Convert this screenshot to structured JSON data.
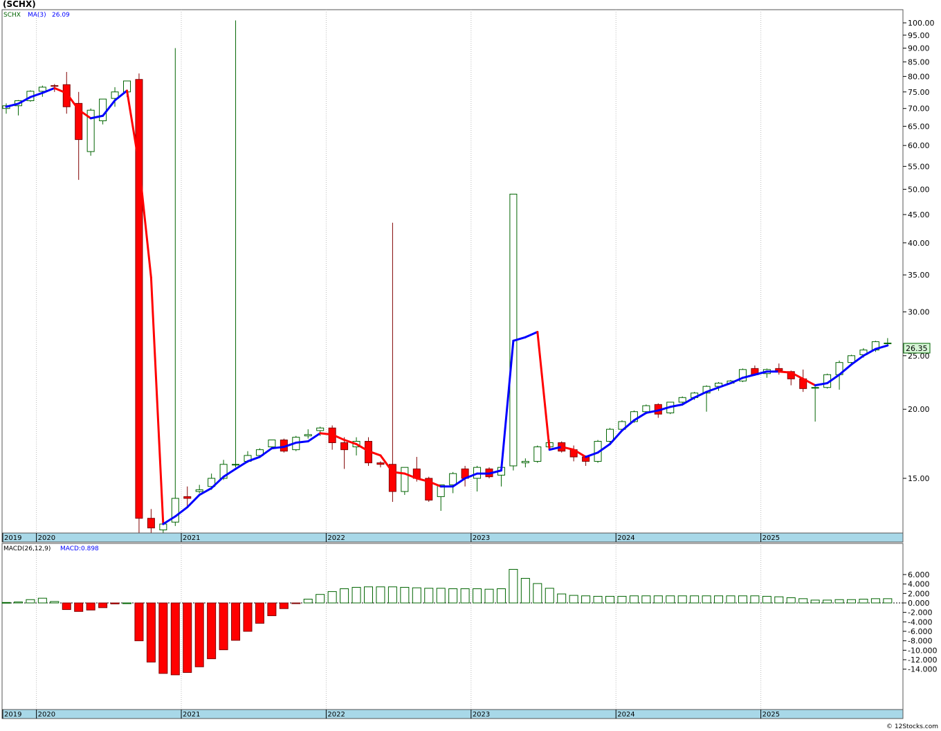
{
  "title": "(SCHX)",
  "credit": "© 12Stocks.com",
  "price_panel": {
    "legend": {
      "symbol": "SCHX",
      "ma_label": "MA(3)",
      "ma_value": "26.09"
    },
    "last_price": "26.35",
    "y_ticks": [
      "100.00",
      "95.00",
      "90.00",
      "85.00",
      "80.00",
      "75.00",
      "70.00",
      "65.00",
      "60.00",
      "55.00",
      "50.00",
      "45.00",
      "40.00",
      "35.00",
      "30.00",
      "25.00",
      "20.00",
      "15.00"
    ]
  },
  "macd_panel": {
    "legend": {
      "label": "MACD(26,12,9)",
      "value_label": "MACD:0.898"
    },
    "y_ticks": [
      "6.000",
      "4.000",
      "2.000",
      "0.000",
      "-2.000",
      "-4.000",
      "-6.000",
      "-8.000",
      "-10.000",
      "-12.000",
      "-14.000"
    ]
  },
  "x_axis": {
    "labels": [
      "2019",
      "2020",
      "2021",
      "2022",
      "2023",
      "2024",
      "2025"
    ]
  },
  "colors": {
    "up": "#006400",
    "down_body": "#ff0000",
    "down_wick": "#800000",
    "ma_up": "#0000ff",
    "ma_down": "#ff0000",
    "axis_band": "#a8d8e8",
    "price_label_bg": "#d6f5d6"
  },
  "chart_data": [
    {
      "type": "candlestick",
      "title": "(SCHX)",
      "interval": "monthly",
      "scale": "log",
      "ylim": [
        12,
        100
      ],
      "start_month": "2019-10",
      "ohlc": [
        [
          70.0,
          71.5,
          68.5,
          70.8
        ],
        [
          70.8,
          72.5,
          68.0,
          72.3
        ],
        [
          72.3,
          75.5,
          72.0,
          75.2
        ],
        [
          75.2,
          77.0,
          73.5,
          76.5
        ],
        [
          77.0,
          77.5,
          75.0,
          76.8
        ],
        [
          77.3,
          81.5,
          68.5,
          70.5
        ],
        [
          71.5,
          75.0,
          52.0,
          61.5
        ],
        [
          58.5,
          70.0,
          57.5,
          69.5
        ],
        [
          66.5,
          72.0,
          65.5,
          72.8
        ],
        [
          73.0,
          76.5,
          70.5,
          75.0
        ],
        [
          75.0,
          78.5,
          73.5,
          78.5
        ],
        [
          79.0,
          81.0,
          11.9,
          12.7
        ],
        [
          12.7,
          13.2,
          11.6,
          12.2
        ],
        [
          12.1,
          12.7,
          11.8,
          12.4
        ],
        [
          12.5,
          90.0,
          12.3,
          13.8
        ],
        [
          13.9,
          14.5,
          13.3,
          13.8
        ],
        [
          14.2,
          14.6,
          14.1,
          14.3
        ],
        [
          14.5,
          15.3,
          14.3,
          15.0
        ],
        [
          15.0,
          16.2,
          14.9,
          15.9
        ],
        [
          15.9,
          101.0,
          15.7,
          15.9
        ],
        [
          16.1,
          16.8,
          16.0,
          16.5
        ],
        [
          16.5,
          17.0,
          16.4,
          16.9
        ],
        [
          17.1,
          17.6,
          17.0,
          17.6
        ],
        [
          17.6,
          17.7,
          16.7,
          16.8
        ],
        [
          16.9,
          17.9,
          16.8,
          17.8
        ],
        [
          17.9,
          18.4,
          17.7,
          18.0
        ],
        [
          18.3,
          18.6,
          17.9,
          18.5
        ],
        [
          18.5,
          18.7,
          16.9,
          17.4
        ],
        [
          17.4,
          17.8,
          15.6,
          16.9
        ],
        [
          17.1,
          17.8,
          16.5,
          17.5
        ],
        [
          17.5,
          17.8,
          15.8,
          16.0
        ],
        [
          16.0,
          16.1,
          15.7,
          15.9
        ],
        [
          15.9,
          43.5,
          13.6,
          14.2
        ],
        [
          14.2,
          15.7,
          14.0,
          15.7
        ],
        [
          15.6,
          16.4,
          14.8,
          15.0
        ],
        [
          15.0,
          15.1,
          13.6,
          13.7
        ],
        [
          13.9,
          14.6,
          13.1,
          14.6
        ],
        [
          14.6,
          15.4,
          14.1,
          15.3
        ],
        [
          15.6,
          15.8,
          14.5,
          15.0
        ],
        [
          15.0,
          15.8,
          14.2,
          15.7
        ],
        [
          15.6,
          15.7,
          15.0,
          15.1
        ],
        [
          15.2,
          15.9,
          14.5,
          15.7
        ],
        [
          15.8,
          49.0,
          15.5,
          49.0
        ],
        [
          16.0,
          16.3,
          15.7,
          16.1
        ],
        [
          16.1,
          17.2,
          16.0,
          17.1
        ],
        [
          17.1,
          17.6,
          16.9,
          17.4
        ],
        [
          17.4,
          17.5,
          16.7,
          16.8
        ],
        [
          16.9,
          17.2,
          16.1,
          16.4
        ],
        [
          16.4,
          16.5,
          15.8,
          16.1
        ],
        [
          16.1,
          17.6,
          16.0,
          17.5
        ],
        [
          17.5,
          18.5,
          17.4,
          18.4
        ],
        [
          18.4,
          19.1,
          18.3,
          19.0
        ],
        [
          19.0,
          19.9,
          18.9,
          19.8
        ],
        [
          19.8,
          20.4,
          19.6,
          20.3
        ],
        [
          20.4,
          20.5,
          19.3,
          19.6
        ],
        [
          19.7,
          20.6,
          19.6,
          20.6
        ],
        [
          20.6,
          21.1,
          20.4,
          21.0
        ],
        [
          21.0,
          21.5,
          20.8,
          21.4
        ],
        [
          21.4,
          22.1,
          19.8,
          22.0
        ],
        [
          22.0,
          22.4,
          21.6,
          22.3
        ],
        [
          22.3,
          22.6,
          22.2,
          22.5
        ],
        [
          22.5,
          23.7,
          22.4,
          23.6
        ],
        [
          23.7,
          24.0,
          23.0,
          23.1
        ],
        [
          23.2,
          23.7,
          22.8,
          23.6
        ],
        [
          23.7,
          24.2,
          23.1,
          23.5
        ],
        [
          23.4,
          23.5,
          22.1,
          22.7
        ],
        [
          22.7,
          23.6,
          21.5,
          21.8
        ],
        [
          21.9,
          22.2,
          19.0,
          21.9
        ],
        [
          21.9,
          23.2,
          21.8,
          23.1
        ],
        [
          23.1,
          24.5,
          21.7,
          24.3
        ],
        [
          24.3,
          25.1,
          24.1,
          25.0
        ],
        [
          25.1,
          25.8,
          24.8,
          25.6
        ],
        [
          25.6,
          26.6,
          25.4,
          26.5
        ],
        [
          26.3,
          26.9,
          26.1,
          26.35
        ]
      ],
      "ma3": [
        70.5,
        71.4,
        73.4,
        74.7,
        76.2,
        74.6,
        69.6,
        67.2,
        67.9,
        72.4,
        75.4,
        55.4,
        34.6,
        12.4,
        12.8,
        13.3,
        14.0,
        14.4,
        15.1,
        15.6,
        16.1,
        16.4,
        17.0,
        17.1,
        17.4,
        17.5,
        18.1,
        18.0,
        17.6,
        17.3,
        16.8,
        16.5,
        15.4,
        15.3,
        15.0,
        14.8,
        14.5,
        14.5,
        15.0,
        15.3,
        15.3,
        15.5,
        26.6,
        27.0,
        27.6,
        16.9,
        17.1,
        16.9,
        16.4,
        16.7,
        17.3,
        18.3,
        19.1,
        19.7,
        19.9,
        20.2,
        20.4,
        21.0,
        21.5,
        21.9,
        22.3,
        22.8,
        23.1,
        23.4,
        23.4,
        23.3,
        22.7,
        22.1,
        22.3,
        23.1,
        24.1,
        25.0,
        25.7,
        26.09
      ],
      "x_tick_labels": [
        "2019",
        "2020",
        "2021",
        "2022",
        "2023",
        "2024",
        "2025"
      ]
    },
    {
      "type": "bar",
      "title": "MACD(26,12,9)",
      "ylim": [
        -15.5,
        7.5
      ],
      "start_month": "2019-10",
      "values": [
        0.1,
        0.2,
        0.7,
        1.0,
        0.3,
        -1.4,
        -1.8,
        -1.5,
        -1.0,
        -0.2,
        0.0,
        -8.0,
        -12.5,
        -14.9,
        -15.2,
        -14.7,
        -13.5,
        -11.8,
        -9.9,
        -7.9,
        -6.0,
        -4.3,
        -2.7,
        -1.2,
        -0.1,
        0.8,
        1.8,
        2.4,
        3.0,
        3.3,
        3.4,
        3.4,
        3.4,
        3.3,
        3.2,
        3.1,
        3.1,
        3.0,
        3.0,
        3.0,
        2.9,
        3.0,
        7.1,
        5.2,
        4.1,
        3.1,
        1.9,
        1.6,
        1.5,
        1.4,
        1.4,
        1.4,
        1.5,
        1.5,
        1.5,
        1.5,
        1.5,
        1.5,
        1.5,
        1.5,
        1.5,
        1.5,
        1.5,
        1.4,
        1.3,
        1.1,
        0.9,
        0.6,
        0.6,
        0.7,
        0.7,
        0.8,
        0.9,
        0.898
      ]
    }
  ]
}
